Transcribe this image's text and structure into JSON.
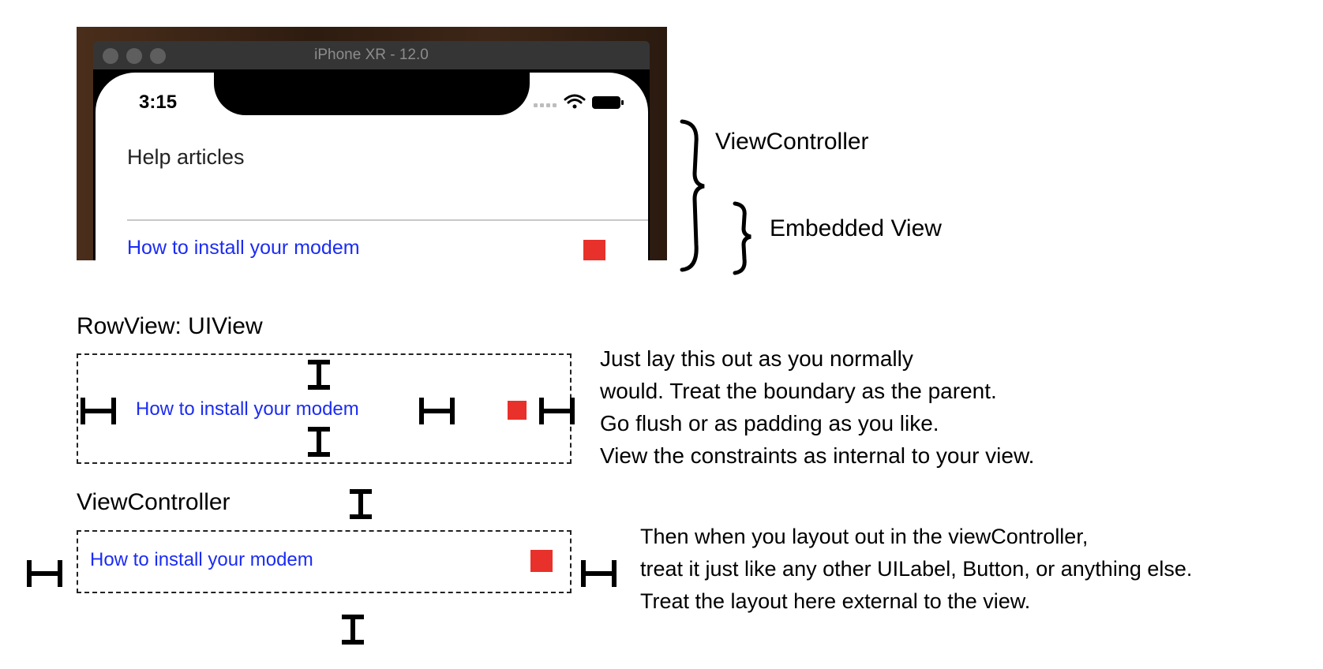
{
  "simulator": {
    "window_title": "iPhone XR - 12.0",
    "status_time": "3:15",
    "nav_title": "Help articles",
    "row_link": "How to install your modem"
  },
  "braces": {
    "view_controller": "ViewController",
    "embedded_view": "Embedded View"
  },
  "rowview_section": {
    "heading": "RowView: UIView",
    "link": "How to install your modem",
    "description_lines": [
      "Just lay this out as you normally",
      "would. Treat the boundary as the parent.",
      "Go flush or as padding as you like.",
      "View the constraints as internal to your view."
    ]
  },
  "viewcontroller_section": {
    "heading": "ViewController",
    "link": "How to install your modem",
    "description_lines": [
      "Then when you layout out in the viewController,",
      "treat it just like any other UILabel, Button, or anything else.",
      "Treat the layout here external to the view."
    ]
  },
  "colors": {
    "link_blue": "#1b2cf2",
    "square_red": "#e8312a",
    "wood": "#3a2416"
  },
  "icons": [
    "wifi-icon",
    "battery-icon",
    "signal-dots-icon",
    "window-control-icon",
    "constraint-vertical-icon",
    "constraint-horizontal-icon",
    "curly-brace-icon"
  ]
}
